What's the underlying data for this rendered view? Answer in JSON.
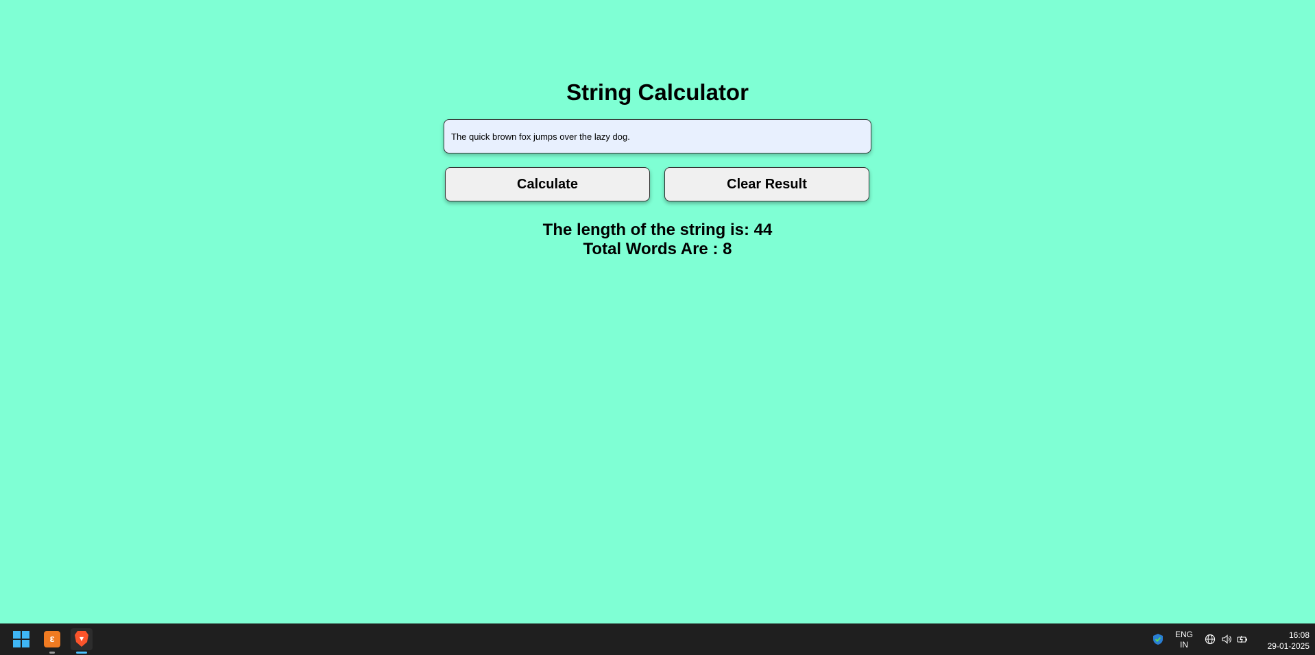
{
  "app": {
    "title": "String Calculator"
  },
  "input": {
    "value": "The quick brown fox jumps over the lazy dog.",
    "placeholder": ""
  },
  "buttons": {
    "calculate_label": "Calculate",
    "clear_label": "Clear Result"
  },
  "result": {
    "length_text": "The length of the string is: 44",
    "words_text": "Total Words Are : 8"
  },
  "taskbar": {
    "apps": [
      {
        "icon": "windows-start-icon"
      },
      {
        "icon": "xampp-icon"
      },
      {
        "icon": "brave-browser-icon"
      }
    ],
    "tray": {
      "lang_top": "ENG",
      "lang_bottom": "IN",
      "time": "16:08",
      "date": "29-01-2025"
    }
  },
  "colors": {
    "background": "#7fffd4",
    "input_bg": "#e8f0fe",
    "button_bg": "#f0f0f0",
    "taskbar_bg": "#1f1f1f"
  }
}
